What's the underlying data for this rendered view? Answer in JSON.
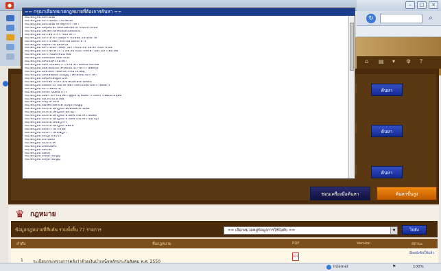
{
  "dropdown": {
    "selected": "== กรุณาเลือกหมวดกฎหมายที่ต้องการค้นหา ==",
    "items": [
      "หมวดกฎหมายพาณิชย์",
      "หมวดกฎหมายการเมืองการปกครอง",
      "หมวดกฎหมายพาณิชย์ เศรษฐกิจ การค้า",
      "หมวดกฎหมายคุ้มครอง ป้องกันสิทธิสาธารณประโยชน์",
      "หมวดกฎหมายองค์กรปกครองส่วนท้องถิ่น",
      "หมวดกฎหมายภาษีอากร การธนาคาร",
      "หมวดกฎหมายการสาธารณสุข การแพทย์ และสุขภาพ",
      "หมวดกฎหมายการเกษตร สหกรณ์ และอาหาร",
      "หมวดกฎหมายยุติธรรม และศาล",
      "หมวดกฎหมายการเงินการคลัง วิธีการงบประมาณ สถาบันการเงิน",
      "หมวดกฎหมายการศึกษา การวิจัย สถาบันการศึกษา และ มหาวิทยาลัย",
      "หมวดกฎหมายการขนส่ง คมนาคม",
      "หมวดกฎหมายพลเมือง พลพาหนะ",
      "หมวดกฎหมายครอบครัว มรดก",
      "หมวดกฎหมายความมั่นคง การรักษาความสงบเรียบร้อย",
      "หมวดกฎหมายเครื่องแบบ เครื่องหมายราชการ เสื้อครุย",
      "หมวดกฎหมายเครื่องราชอิสริยาภรณ์ เหรียญ",
      "หมวดกฎหมายทรัพย์สินทางปัญญา เครื่องหมายการค้า",
      "หมวดกฎหมายคุ้มครองผู้บริโภค",
      "หมวดกฎหมายทรัพยากรธรรมชาติและสิ่งแวดล้อม",
      "หมวดกฎหมายพลังงาน วิทยาศาสตร์ เทคโนโลยี และการสื่อสาร",
      "หมวดกฎหมายการพลังงาน",
      "หมวดกฎหมายกีฬา นันทนาการ",
      "หมวดกฎหมายเด็ก เยาวชน สตรี ผู้สูงอายุ คนพิการ และการพัฒนามนุษย์",
      "หมวดกฎหมายแรงงาน อาชีพ",
      "หมวดกฎหมายรัฐวิสาหกิจ",
      "หมวดกฎหมายองค์กรอิสระตามรัฐธรรมนูญ",
      "หมวดกฎหมายประมวลกฎหมายแพ่งและพาณิชย์",
      "หมวดกฎหมายประมวลกฎหมายอาญา",
      "หมวดกฎหมายประมวลกฎหมายวิธีพิจารณาความแพ่ง",
      "หมวดกฎหมายประมวลกฎหมายวิธีพิจารณาความอาญา",
      "หมวดกฎหมายประมวลรัษฎากร",
      "หมวดกฎหมายประมวลกฎหมายที่ดิน",
      "หมวดกฎหมายพระราชกำหนด",
      "หมวดกฎหมายพระราชกฤษฎีกา",
      "หมวดกฎหมายกฎกระทรวง",
      "หมวดกฎหมายระเบียบ",
      "หมวดกฎหมายประกาศ",
      "หมวดกฎหมายข้อบังคับ",
      "หมวดกฎหมายคำสั่ง",
      "หมวดกฎหมายอื่นๆ",
      "หมวดกฎหมายรัฐธรรมนูญ",
      "หมวดกฎหมายรัฐธรรมนูญ"
    ]
  },
  "search_panel": {
    "search_buttons": [
      "ค้นหา",
      "ค้นหา",
      "ค้นหา",
      "ค้นหา"
    ],
    "hide_button": "ซ่อนเครื่องมือค้นหา",
    "advanced_button": "ค้นหาขั้นสูง"
  },
  "law": {
    "section_title": "กฎหมาย",
    "info_text": "ข้อมูลกฎหมายที่สืบค้น รวมทั้งสิ้น 77 รายการ",
    "category_select": "== เลือกหมวดหมู่ข้อมูลการใช้บังคับ ==",
    "go_button": "ไปยัง",
    "columns": [
      "ลำดับ",
      "ชื่อกฎหมาย",
      "PDF",
      "Version",
      "สถานะ"
    ],
    "rows": [
      {
        "no": "1",
        "title": "ระเบียบกระทรวงการคลังว่าด้วยเงินบำเหน็จหลักประกันสังคม พ.ศ. 2550",
        "pdf": "PDF",
        "version": "",
        "status": "มีผลบังคับใช้แล้ว"
      }
    ]
  },
  "browser": {
    "status_zone": "Internet",
    "zoom": "100%"
  },
  "colors": {
    "panel_brown": "#4a2c0c",
    "button_blue": "#142a8e",
    "button_orange": "#e07800",
    "dropdown_highlight": "#1a3d8c"
  }
}
